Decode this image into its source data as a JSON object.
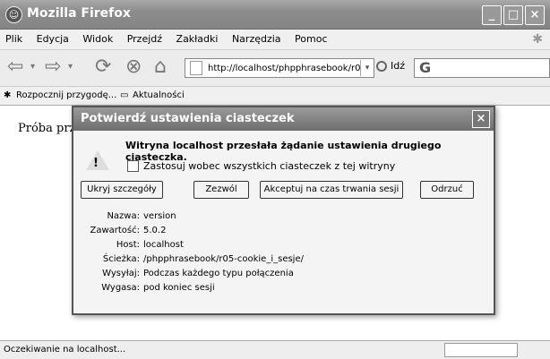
{
  "window": {
    "title": "Mozilla Firefox",
    "min_label": "_",
    "max_label": "□",
    "close_label": "×",
    "logo_glyph": "☺"
  },
  "menu": [
    "Plik",
    "Edycja",
    "Widok",
    "Przejdź",
    "Zakładki",
    "Narzędzia",
    "Pomoc"
  ],
  "nav": {
    "back_glyph": "⇦",
    "forward_glyph": "⇨",
    "reload_glyph": "⟳",
    "stop_glyph": "⊗",
    "home_glyph": "⌂",
    "url": "http://localhost/phpphrasebook/r05",
    "dropdown_glyph": "▾",
    "go_label": "Idź",
    "search_engine_glyph": "G"
  },
  "bookmarks": [
    "Rozpocznij przygodę...",
    "Aktualności"
  ],
  "page": {
    "text": "Próba prz"
  },
  "status": {
    "text": "Oczekiwanie na localhost..."
  },
  "dialog": {
    "title": "Potwierdź ustawienia ciasteczek",
    "close_label": "×",
    "message": "Witryna localhost przesłała żądanie ustawienia drugiego ciasteczka.",
    "warning_mark": "!",
    "checkbox_label": "Zastosuj wobec wszystkich ciasteczek z tej witryny",
    "buttons": {
      "hide": "Ukryj szczegóły",
      "allow": "Zezwól",
      "session": "Akceptuj na czas trwania sesji",
      "deny": "Odrzuć"
    },
    "details": [
      {
        "label": "Nazwa:",
        "value": "version"
      },
      {
        "label": "Zawartość:",
        "value": "5.0.2"
      },
      {
        "label": "Host:",
        "value": "localhost"
      },
      {
        "label": "Ścieżka:",
        "value": "/phpphrasebook/r05-cookie_i_sesje/"
      },
      {
        "label": "Wysyłaj:",
        "value": "Podczas każdego typu połączenia"
      },
      {
        "label": "Wygasa:",
        "value": "pod koniec sesji"
      }
    ]
  }
}
